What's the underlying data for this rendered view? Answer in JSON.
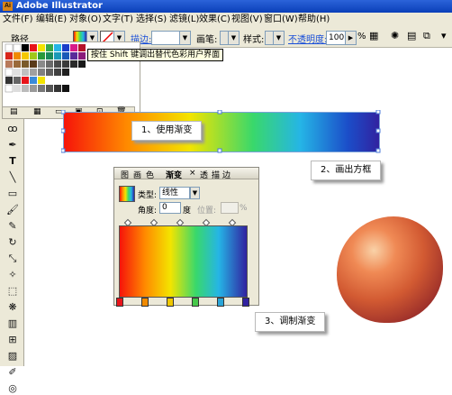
{
  "app": {
    "title": "Adobe Illustrator",
    "logo_text": "Ai"
  },
  "menu": [
    "文件(F)",
    "编辑(E)",
    "对象(O)",
    "文字(T)",
    "选择(S)",
    "滤镜(L)",
    "效果(C)",
    "视图(V)",
    "窗口(W)",
    "帮助(H)"
  ],
  "control_bar": {
    "path_label": "路径",
    "stroke_label": "描边:",
    "brush_label": "画笔:",
    "style_label": "样式:",
    "opacity_label": "不透明度:",
    "opacity_value": "100",
    "percent": "%"
  },
  "tooltip": "按住 Shift 键调出替代色彩用户界面",
  "callouts": {
    "use_gradient": "1、使用渐变",
    "draw_rect": "2、画出方框",
    "adjust_gradient": "3、调制渐变"
  },
  "gradient_panel": {
    "tabs": [
      "图",
      "画",
      "色",
      "渐变",
      "×",
      "透",
      "描",
      "边"
    ],
    "type_label": "类型:",
    "type_value": "线性",
    "angle_label": "角度:",
    "angle_value": "0",
    "degree": "度",
    "position_label": "位置:",
    "percent": "%",
    "stops": [
      "#e8141a",
      "#f08a00",
      "#f0c800",
      "#46c84a",
      "#2aa5d8",
      "#3122a0"
    ]
  },
  "colors": {
    "titlebar": "#0a3fb8",
    "accent_link": "#1a4fd8"
  }
}
